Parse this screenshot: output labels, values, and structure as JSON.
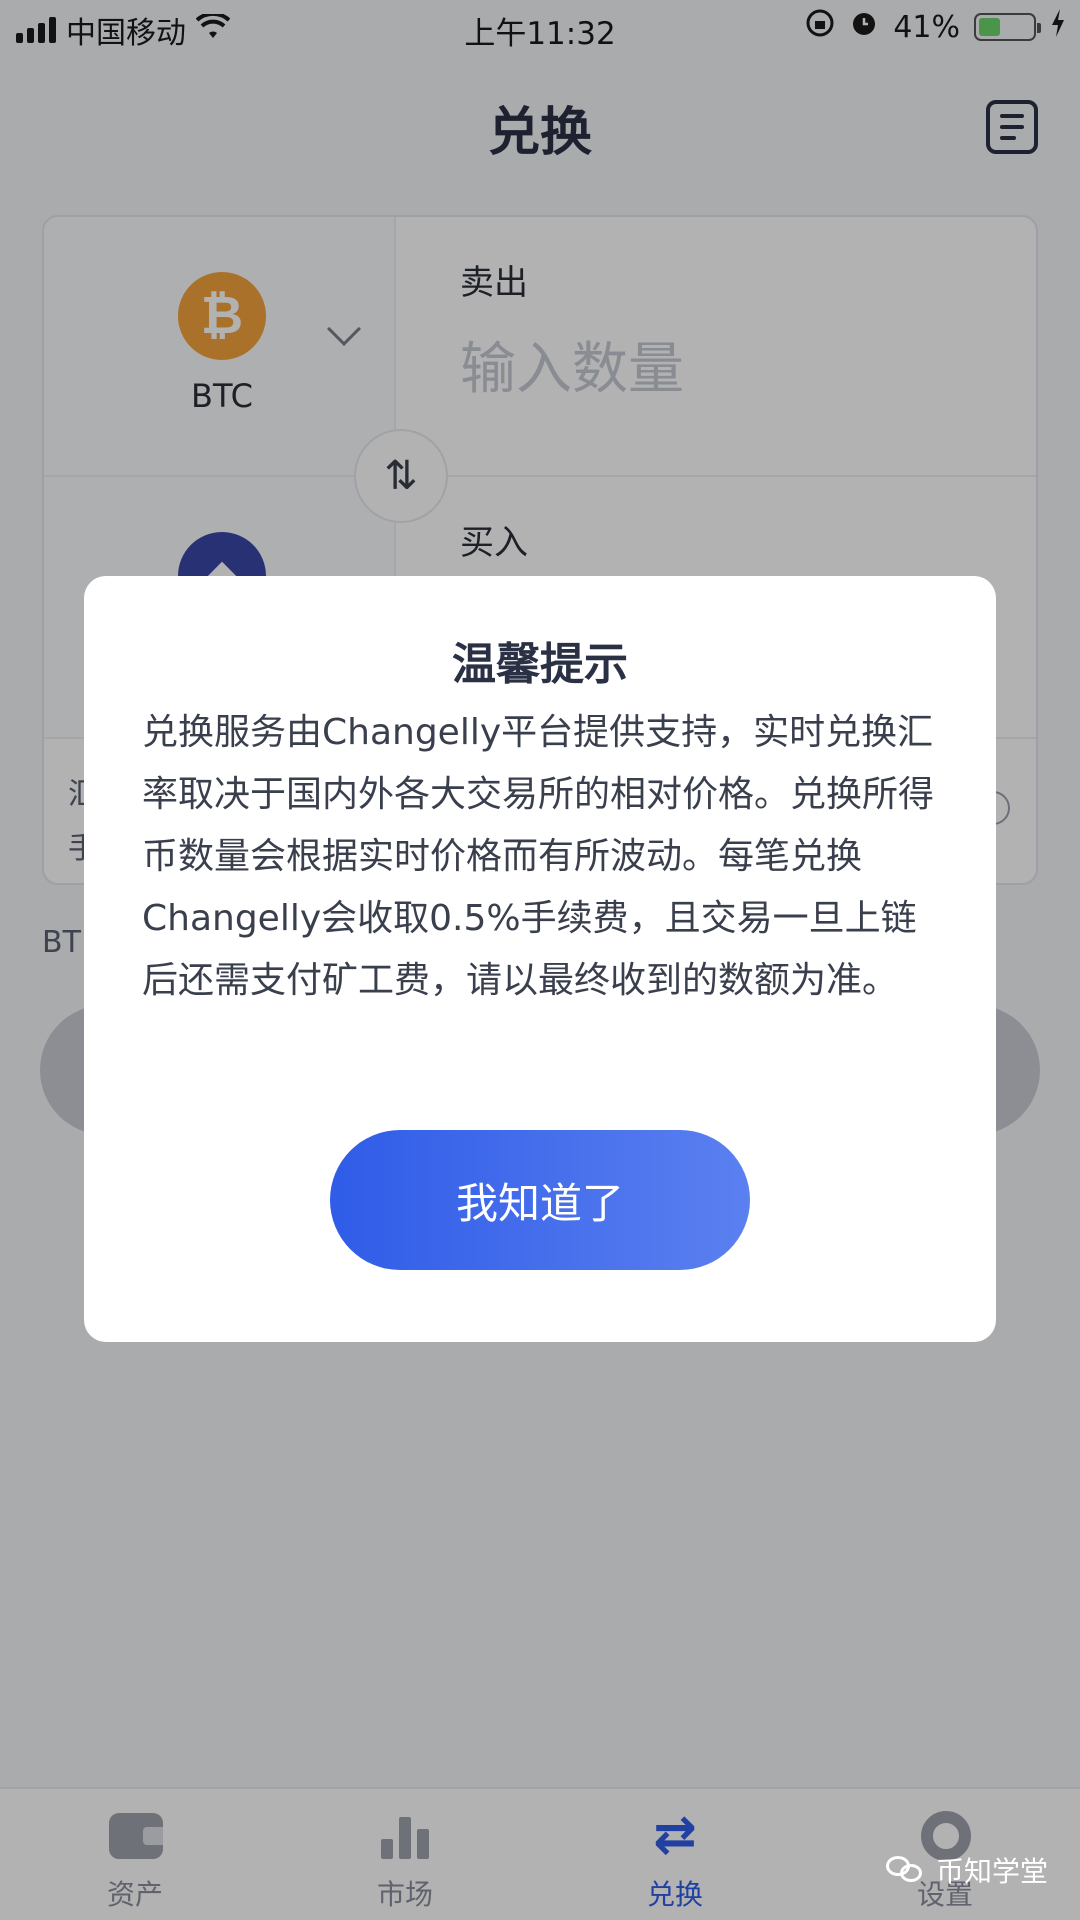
{
  "status_bar": {
    "carrier": "中国移动",
    "time": "上午11:32",
    "battery": "41%",
    "battery_level": 0.41
  },
  "header": {
    "title": "兑换",
    "right_icon": "history-icon"
  },
  "exchange": {
    "sell": {
      "label": "卖出",
      "coin": "BTC",
      "placeholder": "输入数量"
    },
    "buy": {
      "label": "买入"
    },
    "rate_peek_top": "汇",
    "rate_peek_bottom": "手",
    "bottom_peek": "BT"
  },
  "tabs": [
    {
      "label": "资产",
      "icon": "wallet-icon",
      "active": false
    },
    {
      "label": "市场",
      "icon": "chart-bars-icon",
      "active": false
    },
    {
      "label": "兑换",
      "icon": "exchange-arrows-icon",
      "active": true
    },
    {
      "label": "设置",
      "icon": "gear-icon",
      "active": false
    }
  ],
  "dialog": {
    "title": "温馨提示",
    "body": "兑换服务由Changelly平台提供支持，实时兑换汇率取决于国内外各大交易所的相对价格。兑换所得币数量会根据实时价格而有所波动。每笔兑换Changelly会收取0.5%手续费，且交易一旦上链后还需支付矿工费，请以最终收到的数额为准。",
    "confirm_label": "我知道了"
  },
  "watermark": {
    "text": "币知学堂"
  },
  "colors": {
    "accent": "#2f5ce8",
    "btc": "#f2a33c",
    "eth": "#3b47a8"
  }
}
